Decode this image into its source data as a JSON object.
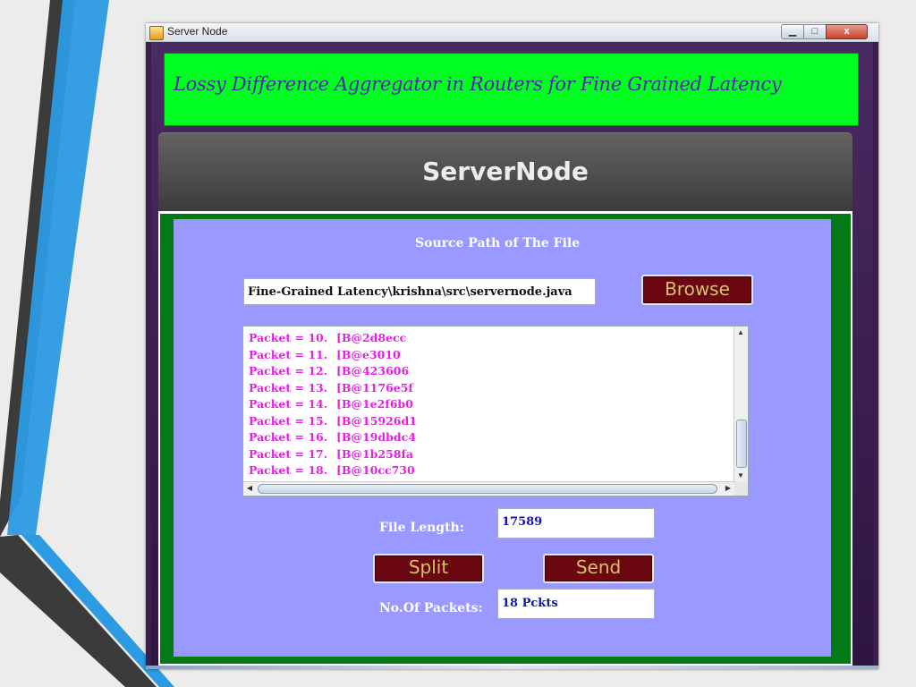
{
  "window": {
    "title": "Server Node",
    "minimize_glyph": "▁",
    "maximize_glyph": "□",
    "close_glyph": "x"
  },
  "banner": {
    "text": "Lossy Difference Aggregator in Routers for Fine Grained Latency",
    "background": "#00ff21",
    "text_color": "#4b2aa8"
  },
  "header": {
    "title": "ServerNode"
  },
  "form": {
    "source_label": "Source Path of The File",
    "source_path": "Fine-Grained Latency\\krishna\\src\\servernode.java",
    "browse_label": "Browse",
    "file_length_label": "File Length:",
    "file_length_value": "17589",
    "split_label": "Split",
    "send_label": "Send",
    "packets_label": "No.Of Packets:",
    "packets_value": "18 Pckts"
  },
  "packets": [
    {
      "label": "Packet = 10.",
      "value": "[B@2d8ecc"
    },
    {
      "label": "Packet = 11.",
      "value": "[B@e3010"
    },
    {
      "label": "Packet = 12.",
      "value": "[B@423606"
    },
    {
      "label": "Packet = 13.",
      "value": "[B@1176e5f"
    },
    {
      "label": "Packet = 14.",
      "value": "[B@1e2f6b0"
    },
    {
      "label": "Packet = 15.",
      "value": "[B@15926d1"
    },
    {
      "label": "Packet = 16.",
      "value": "[B@19dbdc4"
    },
    {
      "label": "Packet = 17.",
      "value": "[B@1b258fa"
    },
    {
      "label": "Packet = 18.",
      "value": "[B@10cc730"
    }
  ],
  "colors": {
    "panel_blue": "#9999ff",
    "panel_green": "#047a16",
    "button_bg": "#6b0710",
    "button_text": "#d5c36a",
    "packet_text": "#e61ee6"
  }
}
